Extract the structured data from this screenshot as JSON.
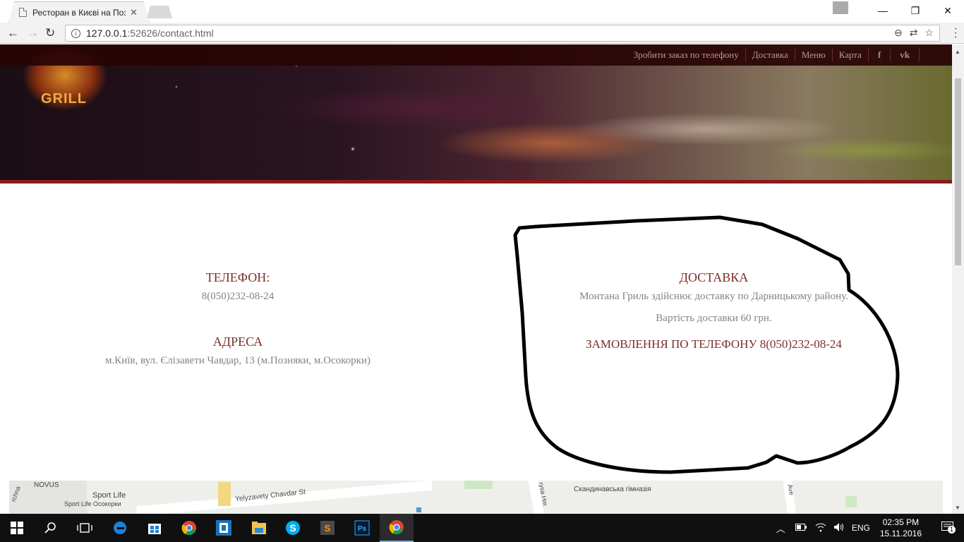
{
  "browser": {
    "tab_title": "Ресторан в Києві на Поз",
    "tab_close": "✕",
    "url_host": "127.0.0.1",
    "url_rest": ":52626/contact.html",
    "info_glyph": "i",
    "win_minimize": "—",
    "win_restore": "❐",
    "win_close": "✕",
    "back": "←",
    "forward": "→",
    "reload": "↻",
    "zoom_icon": "⊖",
    "translate_icon": "⇄",
    "star_icon": "☆"
  },
  "site": {
    "logo_text": "GRILL",
    "nav": [
      {
        "label": "Зробити заказ по телефону"
      },
      {
        "label": "Доставка"
      },
      {
        "label": "Меню"
      },
      {
        "label": "Карта"
      },
      {
        "label": "f"
      },
      {
        "label": "vk"
      }
    ]
  },
  "contact": {
    "phone_heading": "ТЕЛЕФОН:",
    "phone_value": "8(050)232-08-24",
    "address_heading": "АДРЕСА",
    "address_value": "м.Київ, вул. Єлізавети Чавдар, 13 (м.Позняки, м.Осокорки)"
  },
  "delivery": {
    "heading": "ДОСТАВКА",
    "line1": "Монтана Гриль здійснює доставку по Дарницькому району.",
    "line2": "Вартість доставки 60 грн.",
    "order_line": "ЗАМОВЛЕННЯ ПО ТЕЛЕФОНУ 8(050)232-08-24"
  },
  "map": {
    "labels": {
      "novus": "NOVUS",
      "sport_life": "Sport Life",
      "sport_life_osokorky": "Sport Life Осокорки",
      "street": "Yelyzavety Chavdar St",
      "gymnasium": "Скандинавська гімназія",
      "edge_left": "rchna",
      "street_vert": "rysa Hm",
      "ave": "Ave"
    }
  },
  "taskbar": {
    "time": "02:35 PM",
    "date": "15.11.2016",
    "lang": "ENG",
    "notif_count": "1"
  },
  "colors": {
    "heading": "#7a2f28",
    "body_text": "#8a8080",
    "nav_bg": "#280404",
    "accent_line": "#8b1a1a"
  }
}
